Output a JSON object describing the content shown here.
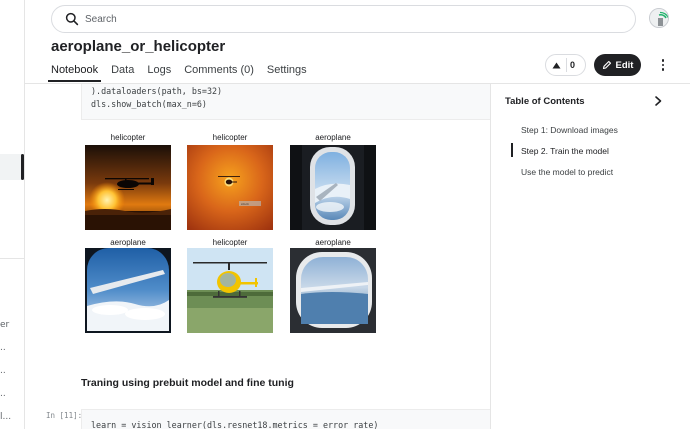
{
  "search": {
    "placeholder": "Search"
  },
  "notebook": {
    "title": "aeroplane_or_helicopter",
    "tabs": [
      {
        "label": "Notebook",
        "active": true
      },
      {
        "label": "Data",
        "active": false
      },
      {
        "label": "Logs",
        "active": false
      },
      {
        "label": "Comments (0)",
        "active": false
      },
      {
        "label": "Settings",
        "active": false
      }
    ],
    "vote_count": "0",
    "edit_label": "Edit"
  },
  "left_rail": {
    "truncated_items": [
      "er",
      "..",
      "..",
      "..",
      "l...",
      ".."
    ]
  },
  "cell_top": {
    "line1": ").dataloaders(path, bs=32)",
    "line2": "dls.show_batch(max_n=6)"
  },
  "batch_images": [
    {
      "label": "helicopter",
      "scene": "helicopter-sunset"
    },
    {
      "label": "helicopter",
      "scene": "helicopter-orange-sky"
    },
    {
      "label": "aeroplane",
      "scene": "airplane-window-wing"
    },
    {
      "label": "aeroplane",
      "scene": "window-wing-clouds"
    },
    {
      "label": "helicopter",
      "scene": "yellow-helicopter-field"
    },
    {
      "label": "aeroplane",
      "scene": "window-ocean-view"
    }
  ],
  "subheading": "Traning using prebuit model and fine tunig",
  "cell_next": {
    "prompt": "In [11]:",
    "code": "learn = vision_learner(dls.resnet18.metrics = error_rate)"
  },
  "toc": {
    "title": "Table of Contents",
    "items": [
      {
        "label": "Step 1: Download images",
        "active": false
      },
      {
        "label": "Step 2. Train the model",
        "active": true
      },
      {
        "label": "Use the model to predict",
        "active": false
      }
    ]
  },
  "icons": {
    "search": "search-icon",
    "avatar": "user-avatar",
    "vote": "upvote-arrow-icon",
    "edit": "pencil-icon",
    "more": "more-vert-icon",
    "toc_toggle": "chevron-right-icon"
  },
  "colors": {
    "primary": "#202124",
    "muted": "#5f6368",
    "border": "#dadce0"
  }
}
